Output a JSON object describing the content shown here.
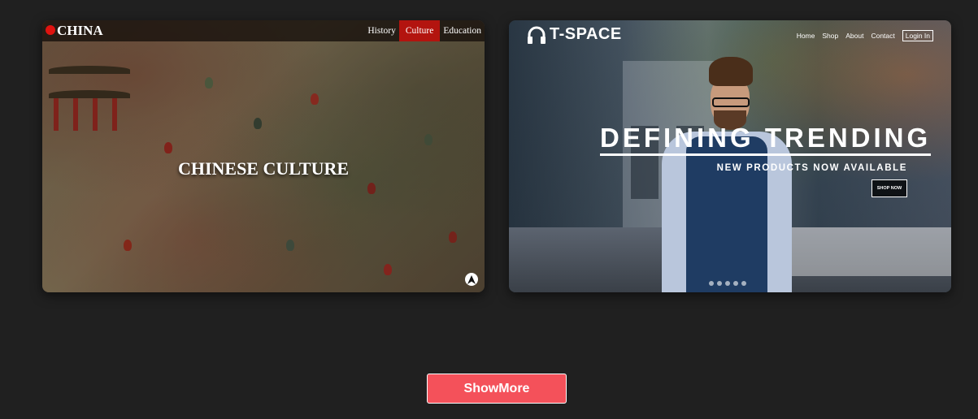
{
  "cards": [
    {
      "logo": "CHINA",
      "nav": [
        "History",
        "Culture",
        "Education"
      ],
      "active_nav": "Culture",
      "heading": "CHINESE CULTURE",
      "accent_color": "#b3140f"
    },
    {
      "logo": "T-SPACE",
      "nav": [
        "Home",
        "Shop",
        "About",
        "Contact"
      ],
      "login": "Login In",
      "title": "DEFINING TRENDING",
      "subtitle": "NEW PRODUCTS NOW AVAILABLE",
      "cta": "SHOP NOW",
      "slide_count": 5,
      "icon": "headphones-icon"
    }
  ],
  "show_more": "ShowMore",
  "colors": {
    "background": "#202020",
    "button": "#f4515a"
  }
}
